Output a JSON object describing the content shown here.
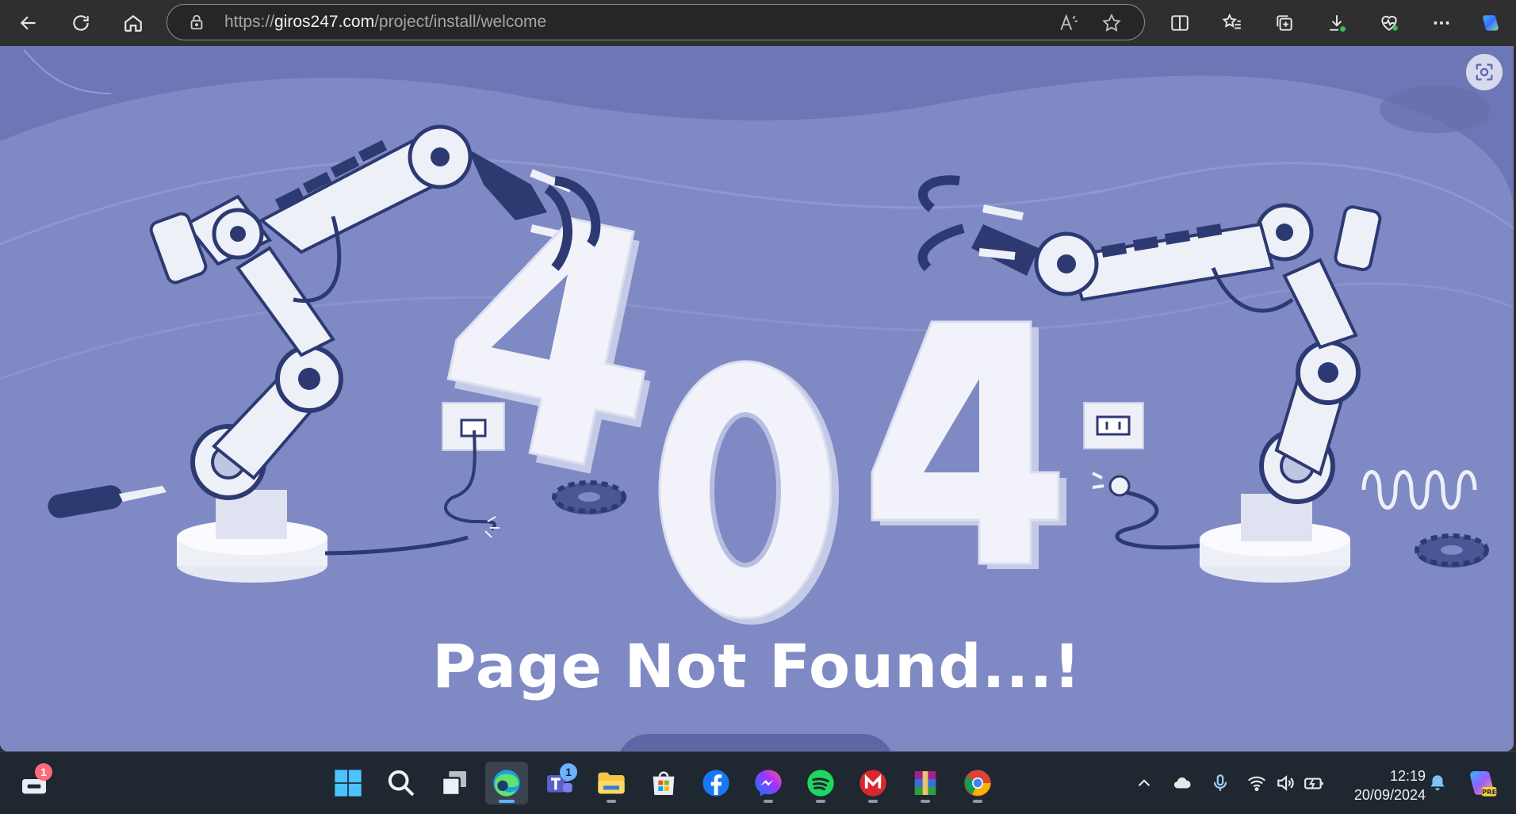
{
  "browser": {
    "url_scheme": "https://",
    "url_host": "giros247.com",
    "url_path": "/project/install/welcome"
  },
  "page": {
    "code_digits": [
      "4",
      "0",
      "4"
    ],
    "title": "Page Not Found...!"
  },
  "taskbar": {
    "widgets_badge": "1",
    "teams_badge": "1",
    "time": "12:19",
    "date": "20/09/2024"
  },
  "colors": {
    "page_bg": "#7f89c4",
    "page_bg_dark": "#6770ad",
    "robot_white": "#eef0f8",
    "robot_navy": "#2d3a72",
    "taskbar_bg": "#1f2730",
    "chrome_bg": "#2f2f2f"
  }
}
